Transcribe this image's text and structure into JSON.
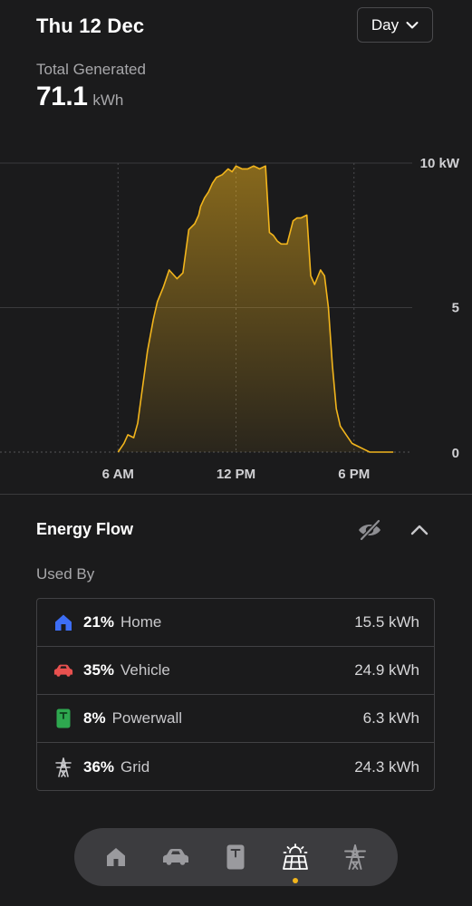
{
  "header": {
    "date": "Thu 12 Dec",
    "range_selector": "Day"
  },
  "summary": {
    "label": "Total Generated",
    "value": "71.1",
    "unit": "kWh"
  },
  "chart_data": {
    "type": "area",
    "title": "",
    "xlabel": "",
    "ylabel": "",
    "color": "#f2b51c",
    "grid": true,
    "x_ticks": [
      "6 AM",
      "12 PM",
      "6 PM"
    ],
    "y_ticks": [
      "10 kW",
      "5",
      "0"
    ],
    "xlim": [
      0,
      24
    ],
    "ylim": [
      0,
      10
    ],
    "series": [
      {
        "x": [
          0,
          6.0,
          6.3,
          6.5,
          6.8,
          7.0,
          7.2,
          7.5,
          7.8,
          8.0,
          8.3,
          8.6,
          9.0,
          9.3,
          9.6,
          9.9,
          10.1,
          10.2,
          10.4,
          10.6,
          10.8,
          11.0,
          11.3,
          11.6,
          11.8,
          12.0,
          12.3,
          12.6,
          12.9,
          13.2,
          13.5,
          13.7,
          13.9,
          14.1,
          14.3,
          14.6,
          14.9,
          15.1,
          15.3,
          15.6,
          15.8,
          16.0,
          16.3,
          16.5,
          16.7,
          16.9,
          17.1,
          17.3,
          17.6,
          17.9,
          18.2,
          18.5,
          18.8,
          19.2,
          19.5,
          19.8,
          20.0,
          24
        ],
        "y": [
          0,
          0.0,
          0.3,
          0.6,
          0.5,
          1.0,
          2.0,
          3.5,
          4.6,
          5.2,
          5.7,
          6.3,
          6.0,
          6.2,
          7.7,
          7.9,
          8.2,
          8.5,
          8.8,
          9.0,
          9.3,
          9.5,
          9.6,
          9.8,
          9.7,
          9.9,
          9.8,
          9.8,
          9.9,
          9.8,
          9.9,
          7.6,
          7.5,
          7.3,
          7.2,
          7.2,
          8.0,
          8.1,
          8.1,
          8.2,
          6.1,
          5.8,
          6.3,
          6.1,
          5.0,
          3.0,
          1.5,
          0.9,
          0.6,
          0.3,
          0.2,
          0.1,
          0.0,
          0.0,
          0.0,
          0.0,
          0.0,
          0
        ]
      }
    ]
  },
  "energy_flow": {
    "title": "Energy Flow",
    "used_by_label": "Used By",
    "rows": [
      {
        "icon": "home-icon",
        "pct": "21%",
        "name": "Home",
        "value": "15.5 kWh",
        "color": "#3d6ef5"
      },
      {
        "icon": "vehicle-icon",
        "pct": "35%",
        "name": "Vehicle",
        "value": "24.9 kWh",
        "color": "#e8514f"
      },
      {
        "icon": "powerwall-icon",
        "pct": "8%",
        "name": "Powerwall",
        "value": "6.3 kWh",
        "color": "#2ea84f"
      },
      {
        "icon": "grid-tower-icon",
        "pct": "36%",
        "name": "Grid",
        "value": "24.3 kWh",
        "color": "#c8c8cb"
      }
    ]
  },
  "bottom_nav": {
    "items": [
      "home-icon",
      "vehicle-icon",
      "powerwall-icon",
      "solar-icon",
      "grid-tower-icon"
    ],
    "active": "solar-icon",
    "active_color": "#f2b51c"
  }
}
